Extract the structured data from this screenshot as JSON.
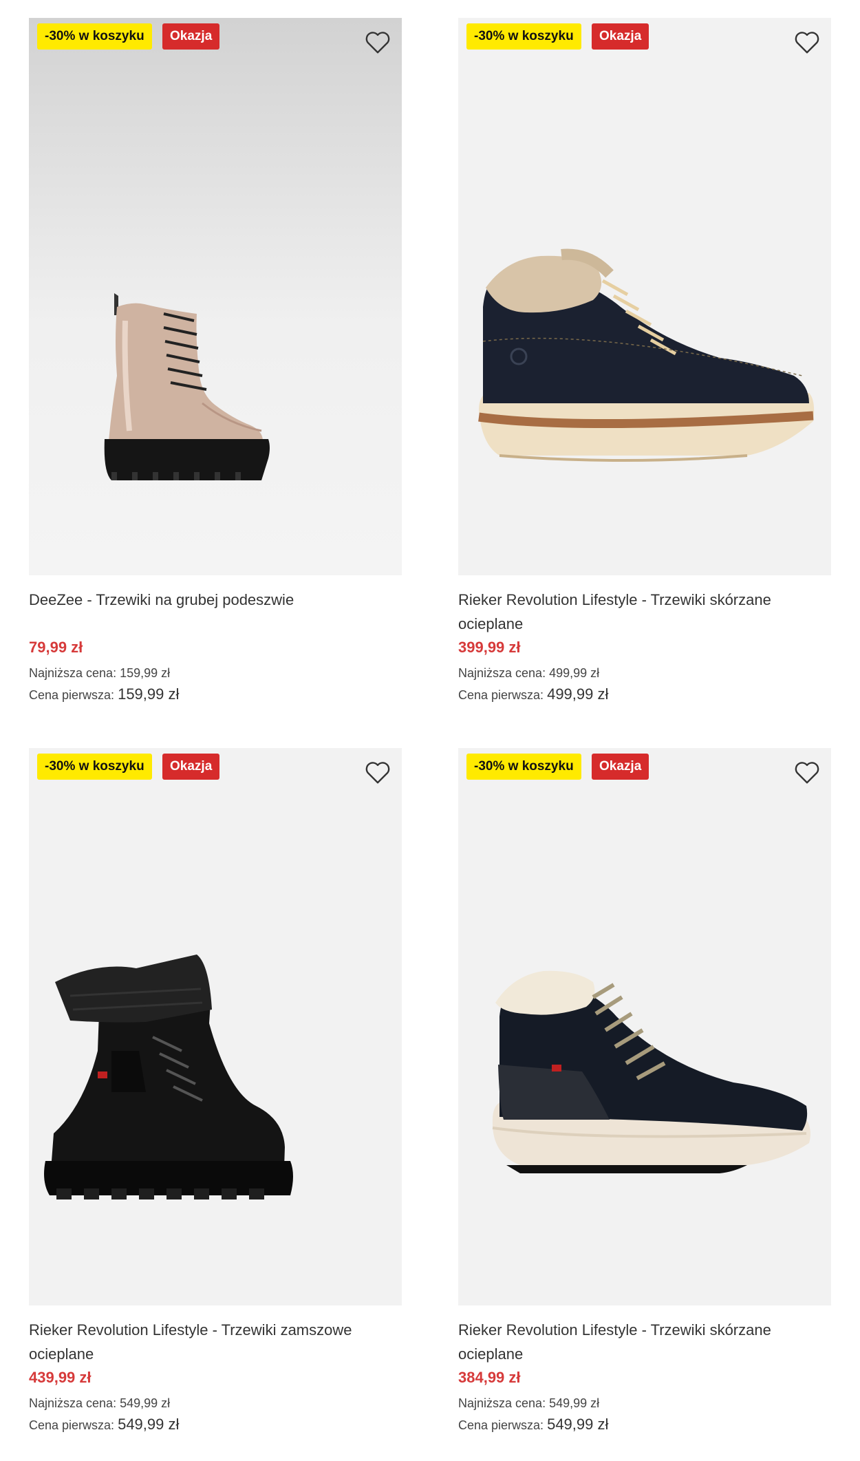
{
  "products": [
    {
      "promo_badge": "-30% w koszyku",
      "sale_badge": "Okazja",
      "title": "DeeZee - Trzewiki na grubej podeszwie",
      "price": "79,99 zł",
      "lowest_label": "Najniższa cena:",
      "lowest_value": "159,99 zł",
      "first_label": "Cena pierwsza:",
      "first_value": "159,99 zł"
    },
    {
      "promo_badge": "-30% w koszyku",
      "sale_badge": "Okazja",
      "title": "Rieker Revolution Lifestyle - Trzewiki skórzane ocieplane",
      "price": "399,99 zł",
      "lowest_label": "Najniższa cena:",
      "lowest_value": "499,99 zł",
      "first_label": "Cena pierwsza:",
      "first_value": "499,99 zł"
    },
    {
      "promo_badge": "-30% w koszyku",
      "sale_badge": "Okazja",
      "title": "Rieker Revolution Lifestyle - Trzewiki zamszowe ocieplane",
      "price": "439,99 zł",
      "lowest_label": "Najniższa cena:",
      "lowest_value": "549,99 zł",
      "first_label": "Cena pierwsza:",
      "first_value": "549,99 zł"
    },
    {
      "promo_badge": "-30% w koszyku",
      "sale_badge": "Okazja",
      "title": "Rieker Revolution Lifestyle - Trzewiki skórzane ocieplane",
      "price": "384,99 zł",
      "lowest_label": "Najniższa cena:",
      "lowest_value": "549,99 zł",
      "first_label": "Cena pierwsza:",
      "first_value": "549,99 zł"
    }
  ],
  "colors": {
    "promo": "#ffea00",
    "sale": "#d62b2b",
    "price": "#d63a3a"
  },
  "icons": {
    "wishlist": "heart-outline-icon"
  }
}
